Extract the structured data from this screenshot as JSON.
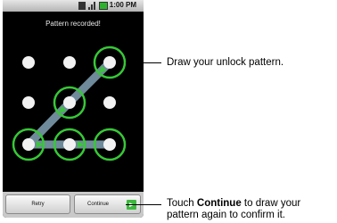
{
  "status_bar": {
    "time": "1:00 PM"
  },
  "banner": {
    "text": "Pattern recorded!"
  },
  "pattern": {
    "rows": 3,
    "cols": 3,
    "dot_color": "#f2f2f2",
    "path_color": "#6f8a9a",
    "ring_color": "#37c837",
    "arrow_color": "#37c837",
    "selected_sequence": [
      [
        0,
        2
      ],
      [
        1,
        1
      ],
      [
        2,
        0
      ],
      [
        2,
        1
      ],
      [
        2,
        2
      ]
    ]
  },
  "buttons": {
    "retry_label": "Retry",
    "continue_label": "Continue",
    "continue_icon": "arrow-right-icon"
  },
  "callouts": {
    "top": "Draw your unlock pattern.",
    "bottom_prefix": "Touch ",
    "bottom_bold": "Continue",
    "bottom_suffix": " to draw your",
    "bottom_line2": "pattern again to confirm it."
  }
}
